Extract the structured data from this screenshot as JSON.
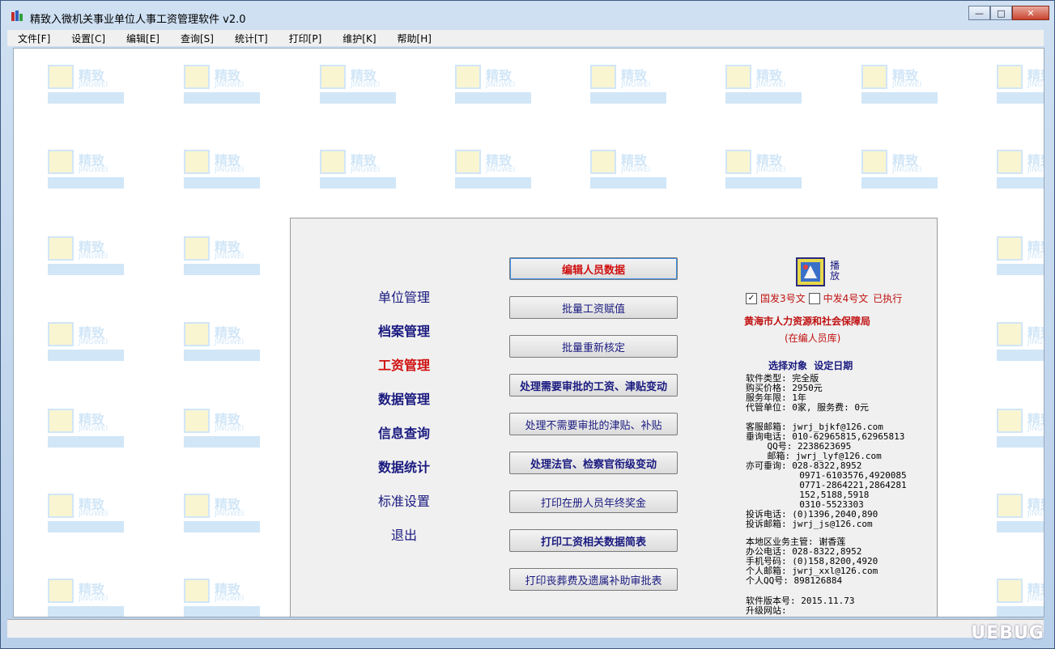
{
  "window": {
    "title": "精致入微机关事业单位人事工资管理软件 v2.0",
    "min_label": "—",
    "max_label": "□",
    "close_label": "✕"
  },
  "menu": [
    "文件[F]",
    "设置[C]",
    "编辑[E]",
    "查询[S]",
    "统计[T]",
    "打印[P]",
    "维护[K]",
    "帮助[H]"
  ],
  "watermark": {
    "line1": "精致",
    "line2": "JINGWEI"
  },
  "nav": [
    {
      "label": "单位管理",
      "color": "#1a1a80",
      "bold": false
    },
    {
      "label": "档案管理",
      "color": "#1a1a80",
      "bold": true
    },
    {
      "label": "工资管理",
      "color": "#d01010",
      "bold": true
    },
    {
      "label": "数据管理",
      "color": "#1a1a80",
      "bold": true
    },
    {
      "label": "信息查询",
      "color": "#1a1a80",
      "bold": true
    },
    {
      "label": "数据统计",
      "color": "#1a1a80",
      "bold": true
    },
    {
      "label": "标准设置",
      "color": "#1a1a80",
      "bold": false
    },
    {
      "label": "退出",
      "color": "#1a1a80",
      "bold": false
    }
  ],
  "buttons": [
    {
      "label": "编辑人员数据",
      "color": "#d01010",
      "bold": true
    },
    {
      "label": "批量工资赋值",
      "color": "#1a1a80",
      "bold": false
    },
    {
      "label": "批量重新核定",
      "color": "#1a1a80",
      "bold": false
    },
    {
      "label": "处理需要审批的工资、津贴变动",
      "color": "#1a1a80",
      "bold": true
    },
    {
      "label": "处理不需要审批的津贴、补贴",
      "color": "#1a1a80",
      "bold": false
    },
    {
      "label": "处理法官、检察官衔级变动",
      "color": "#1a1a80",
      "bold": true
    },
    {
      "label": "打印在册人员年终奖金",
      "color": "#1a1a80",
      "bold": false
    },
    {
      "label": "打印工资相关数据简表",
      "color": "#1a1a80",
      "bold": true
    },
    {
      "label": "打印丧葬费及遗属补助审批表",
      "color": "#1a1a80",
      "bold": false
    }
  ],
  "right": {
    "play_label_1": "播",
    "play_label_2": "放",
    "doc3_label": "国发3号文",
    "doc4_label": "中发4号文",
    "executed": "已执行",
    "bureau": "黄海市人力资源和社会保障局",
    "bureau_sub": "(在编人员库)",
    "select_label": "选择对象",
    "date_label": "设定日期",
    "info_blocks": [
      "软件类型: 完全版\n购买价格: 2950元\n服务年限: 1年\n代管单位: 0家, 服务费: 0元",
      "客服邮箱: jwrj_bjkf@126.com\n垂询电话: 010-62965815,62965813\n    QQ号: 2238623695\n    邮箱: jwrj_lyf@126.com\n亦可垂询: 028-8322,8952\n          0971-6103576,4920085\n          0771-2864221,2864281\n          152,5188,5918\n          0310-5523303\n投诉电话: (0)1396,2040,890\n投诉邮箱: jwrj_js@126.com",
      "本地区业务主管: 谢香莲\n办公电话: 028-8322,8952\n手机号码: (0)158,8200,4920\n个人邮箱: jwrj_xxl@126.com\n个人QQ号: 898126884",
      "软件版本号: 2015.11.73\n升级网站:"
    ]
  },
  "corner_logo": "UEBUG"
}
